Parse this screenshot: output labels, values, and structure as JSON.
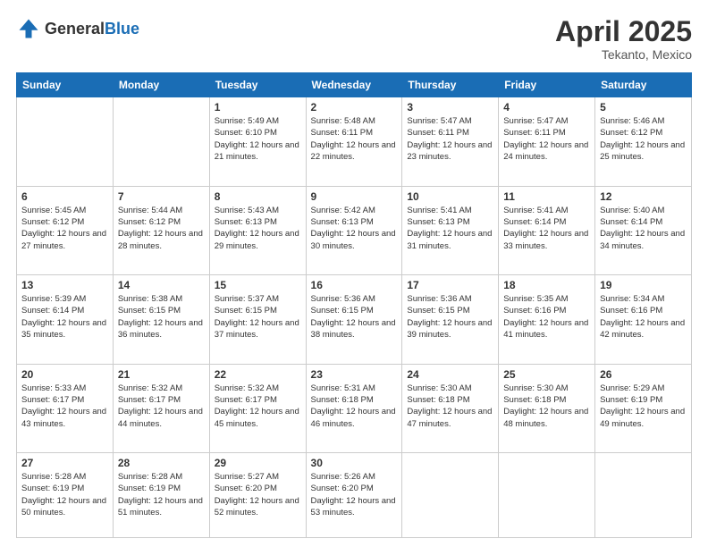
{
  "header": {
    "logo_general": "General",
    "logo_blue": "Blue",
    "title": "April 2025",
    "subtitle": "Tekanto, Mexico"
  },
  "days_of_week": [
    "Sunday",
    "Monday",
    "Tuesday",
    "Wednesday",
    "Thursday",
    "Friday",
    "Saturday"
  ],
  "weeks": [
    [
      {
        "day": "",
        "info": ""
      },
      {
        "day": "",
        "info": ""
      },
      {
        "day": "1",
        "info": "Sunrise: 5:49 AM\nSunset: 6:10 PM\nDaylight: 12 hours and 21 minutes."
      },
      {
        "day": "2",
        "info": "Sunrise: 5:48 AM\nSunset: 6:11 PM\nDaylight: 12 hours and 22 minutes."
      },
      {
        "day": "3",
        "info": "Sunrise: 5:47 AM\nSunset: 6:11 PM\nDaylight: 12 hours and 23 minutes."
      },
      {
        "day": "4",
        "info": "Sunrise: 5:47 AM\nSunset: 6:11 PM\nDaylight: 12 hours and 24 minutes."
      },
      {
        "day": "5",
        "info": "Sunrise: 5:46 AM\nSunset: 6:12 PM\nDaylight: 12 hours and 25 minutes."
      }
    ],
    [
      {
        "day": "6",
        "info": "Sunrise: 5:45 AM\nSunset: 6:12 PM\nDaylight: 12 hours and 27 minutes."
      },
      {
        "day": "7",
        "info": "Sunrise: 5:44 AM\nSunset: 6:12 PM\nDaylight: 12 hours and 28 minutes."
      },
      {
        "day": "8",
        "info": "Sunrise: 5:43 AM\nSunset: 6:13 PM\nDaylight: 12 hours and 29 minutes."
      },
      {
        "day": "9",
        "info": "Sunrise: 5:42 AM\nSunset: 6:13 PM\nDaylight: 12 hours and 30 minutes."
      },
      {
        "day": "10",
        "info": "Sunrise: 5:41 AM\nSunset: 6:13 PM\nDaylight: 12 hours and 31 minutes."
      },
      {
        "day": "11",
        "info": "Sunrise: 5:41 AM\nSunset: 6:14 PM\nDaylight: 12 hours and 33 minutes."
      },
      {
        "day": "12",
        "info": "Sunrise: 5:40 AM\nSunset: 6:14 PM\nDaylight: 12 hours and 34 minutes."
      }
    ],
    [
      {
        "day": "13",
        "info": "Sunrise: 5:39 AM\nSunset: 6:14 PM\nDaylight: 12 hours and 35 minutes."
      },
      {
        "day": "14",
        "info": "Sunrise: 5:38 AM\nSunset: 6:15 PM\nDaylight: 12 hours and 36 minutes."
      },
      {
        "day": "15",
        "info": "Sunrise: 5:37 AM\nSunset: 6:15 PM\nDaylight: 12 hours and 37 minutes."
      },
      {
        "day": "16",
        "info": "Sunrise: 5:36 AM\nSunset: 6:15 PM\nDaylight: 12 hours and 38 minutes."
      },
      {
        "day": "17",
        "info": "Sunrise: 5:36 AM\nSunset: 6:15 PM\nDaylight: 12 hours and 39 minutes."
      },
      {
        "day": "18",
        "info": "Sunrise: 5:35 AM\nSunset: 6:16 PM\nDaylight: 12 hours and 41 minutes."
      },
      {
        "day": "19",
        "info": "Sunrise: 5:34 AM\nSunset: 6:16 PM\nDaylight: 12 hours and 42 minutes."
      }
    ],
    [
      {
        "day": "20",
        "info": "Sunrise: 5:33 AM\nSunset: 6:17 PM\nDaylight: 12 hours and 43 minutes."
      },
      {
        "day": "21",
        "info": "Sunrise: 5:32 AM\nSunset: 6:17 PM\nDaylight: 12 hours and 44 minutes."
      },
      {
        "day": "22",
        "info": "Sunrise: 5:32 AM\nSunset: 6:17 PM\nDaylight: 12 hours and 45 minutes."
      },
      {
        "day": "23",
        "info": "Sunrise: 5:31 AM\nSunset: 6:18 PM\nDaylight: 12 hours and 46 minutes."
      },
      {
        "day": "24",
        "info": "Sunrise: 5:30 AM\nSunset: 6:18 PM\nDaylight: 12 hours and 47 minutes."
      },
      {
        "day": "25",
        "info": "Sunrise: 5:30 AM\nSunset: 6:18 PM\nDaylight: 12 hours and 48 minutes."
      },
      {
        "day": "26",
        "info": "Sunrise: 5:29 AM\nSunset: 6:19 PM\nDaylight: 12 hours and 49 minutes."
      }
    ],
    [
      {
        "day": "27",
        "info": "Sunrise: 5:28 AM\nSunset: 6:19 PM\nDaylight: 12 hours and 50 minutes."
      },
      {
        "day": "28",
        "info": "Sunrise: 5:28 AM\nSunset: 6:19 PM\nDaylight: 12 hours and 51 minutes."
      },
      {
        "day": "29",
        "info": "Sunrise: 5:27 AM\nSunset: 6:20 PM\nDaylight: 12 hours and 52 minutes."
      },
      {
        "day": "30",
        "info": "Sunrise: 5:26 AM\nSunset: 6:20 PM\nDaylight: 12 hours and 53 minutes."
      },
      {
        "day": "",
        "info": ""
      },
      {
        "day": "",
        "info": ""
      },
      {
        "day": "",
        "info": ""
      }
    ]
  ]
}
